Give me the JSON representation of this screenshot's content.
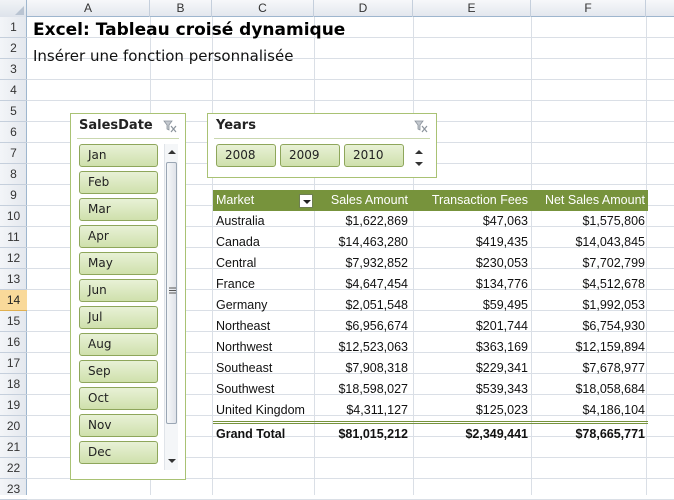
{
  "grid": {
    "columns": [
      "A",
      "B",
      "C",
      "D",
      "E",
      "F"
    ],
    "rows": [
      "1",
      "2",
      "3",
      "4",
      "5",
      "6",
      "7",
      "8",
      "9",
      "10",
      "11",
      "12",
      "13",
      "14",
      "15",
      "16",
      "17",
      "18",
      "19",
      "20",
      "21",
      "22",
      "23"
    ],
    "selected_row": "14"
  },
  "sheet": {
    "title": "Excel: Tableau croisé dynamique",
    "subtitle": "Insérer une fonction personnalisée"
  },
  "slicer_salesdate": {
    "title": "SalesDate",
    "items": [
      "Jan",
      "Feb",
      "Mar",
      "Apr",
      "May",
      "Jun",
      "Jul",
      "Aug",
      "Sep",
      "Oct",
      "Nov",
      "Dec"
    ]
  },
  "slicer_years": {
    "title": "Years",
    "items": [
      "2008",
      "2009",
      "2010"
    ]
  },
  "pivot": {
    "headers": [
      "Market",
      "Sales Amount",
      "Transaction Fees",
      "Net Sales Amount"
    ],
    "rows": [
      {
        "market": "Australia",
        "sales": "$1,622,869",
        "fees": "$47,063",
        "net": "$1,575,806"
      },
      {
        "market": "Canada",
        "sales": "$14,463,280",
        "fees": "$419,435",
        "net": "$14,043,845"
      },
      {
        "market": "Central",
        "sales": "$7,932,852",
        "fees": "$230,053",
        "net": "$7,702,799"
      },
      {
        "market": "France",
        "sales": "$4,647,454",
        "fees": "$134,776",
        "net": "$4,512,678"
      },
      {
        "market": "Germany",
        "sales": "$2,051,548",
        "fees": "$59,495",
        "net": "$1,992,053"
      },
      {
        "market": "Northeast",
        "sales": "$6,956,674",
        "fees": "$201,744",
        "net": "$6,754,930"
      },
      {
        "market": "Northwest",
        "sales": "$12,523,063",
        "fees": "$363,169",
        "net": "$12,159,894"
      },
      {
        "market": "Southeast",
        "sales": "$7,908,318",
        "fees": "$229,341",
        "net": "$7,678,977"
      },
      {
        "market": "Southwest",
        "sales": "$18,598,027",
        "fees": "$539,343",
        "net": "$18,058,684"
      },
      {
        "market": "United Kingdom",
        "sales": "$4,311,127",
        "fees": "$125,023",
        "net": "$4,186,104"
      }
    ],
    "total": {
      "market": "Grand Total",
      "sales": "$81,015,212",
      "fees": "$2,349,441",
      "net": "$78,665,771"
    }
  },
  "colors": {
    "pivot_header": "#77933c",
    "slicer_chip": "#cfe0ac",
    "selected_row": "#f9d99a"
  }
}
